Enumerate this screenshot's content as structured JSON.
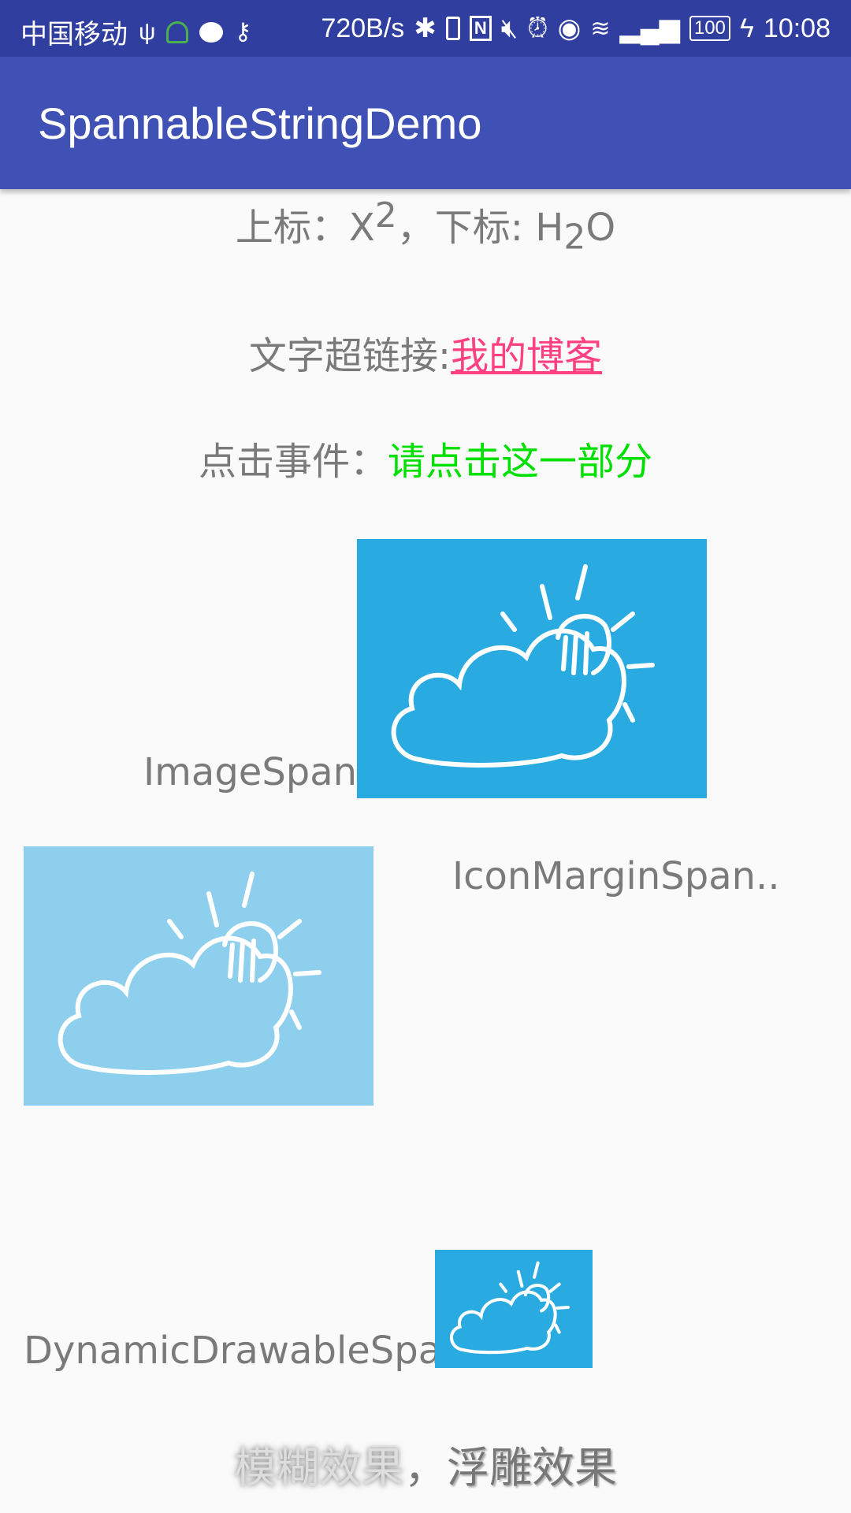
{
  "status_bar": {
    "carrier": "中国移动",
    "speed": "720B/s",
    "battery": "100",
    "time": "10:08",
    "icons": [
      "usb-icon",
      "headset-icon",
      "chat-icon",
      "key-icon",
      "bluetooth-icon",
      "vibrate-icon",
      "nfc-icon",
      "mute-icon",
      "alarm-icon",
      "eye-icon",
      "wifi-icon",
      "signal-icon",
      "battery-icon",
      "charging-icon"
    ]
  },
  "app_bar": {
    "title": "SpannableStringDemo"
  },
  "content": {
    "super_label": "上标：",
    "super_base": "X",
    "super_exp": "2",
    "sub_label": "，下标: H",
    "sub_num": "2",
    "sub_tail": "O",
    "link_label": "文字超链接:",
    "link_text": "我的博客",
    "click_label": "点击事件：",
    "click_text": "请点击这一部分",
    "image_span_label": "ImageSpan",
    "icon_margin_label": "IconMarginSpan..",
    "dynamic_label": "DynamicDrawableSpa",
    "blur_text": "模糊效果",
    "separator": "，",
    "emboss_text": "浮雕效果"
  },
  "colors": {
    "primary": "#3f51b5",
    "primary_dark": "#303f9f",
    "accent": "#ff4081",
    "click": "#00e000",
    "image_bg": "#29abe2",
    "image_bg_light": "#8ecfee"
  }
}
